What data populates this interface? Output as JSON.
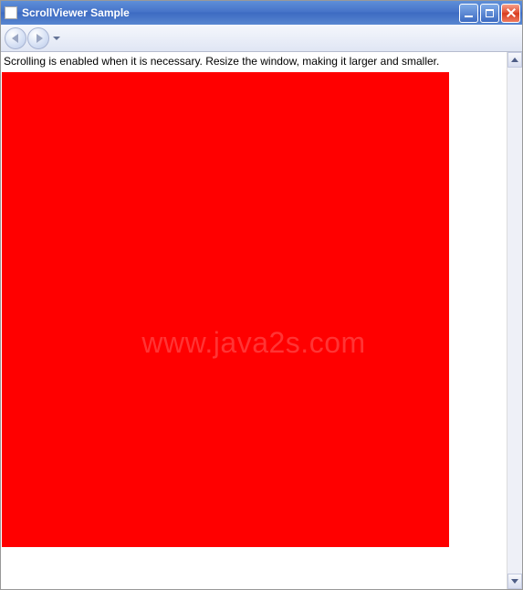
{
  "window": {
    "title": "ScrollViewer Sample"
  },
  "content": {
    "instruction": "Scrolling is enabled when it is necessary. Resize the window, making it larger and smaller.",
    "watermark": "www.java2s.com",
    "rect_color": "#ff0000"
  }
}
